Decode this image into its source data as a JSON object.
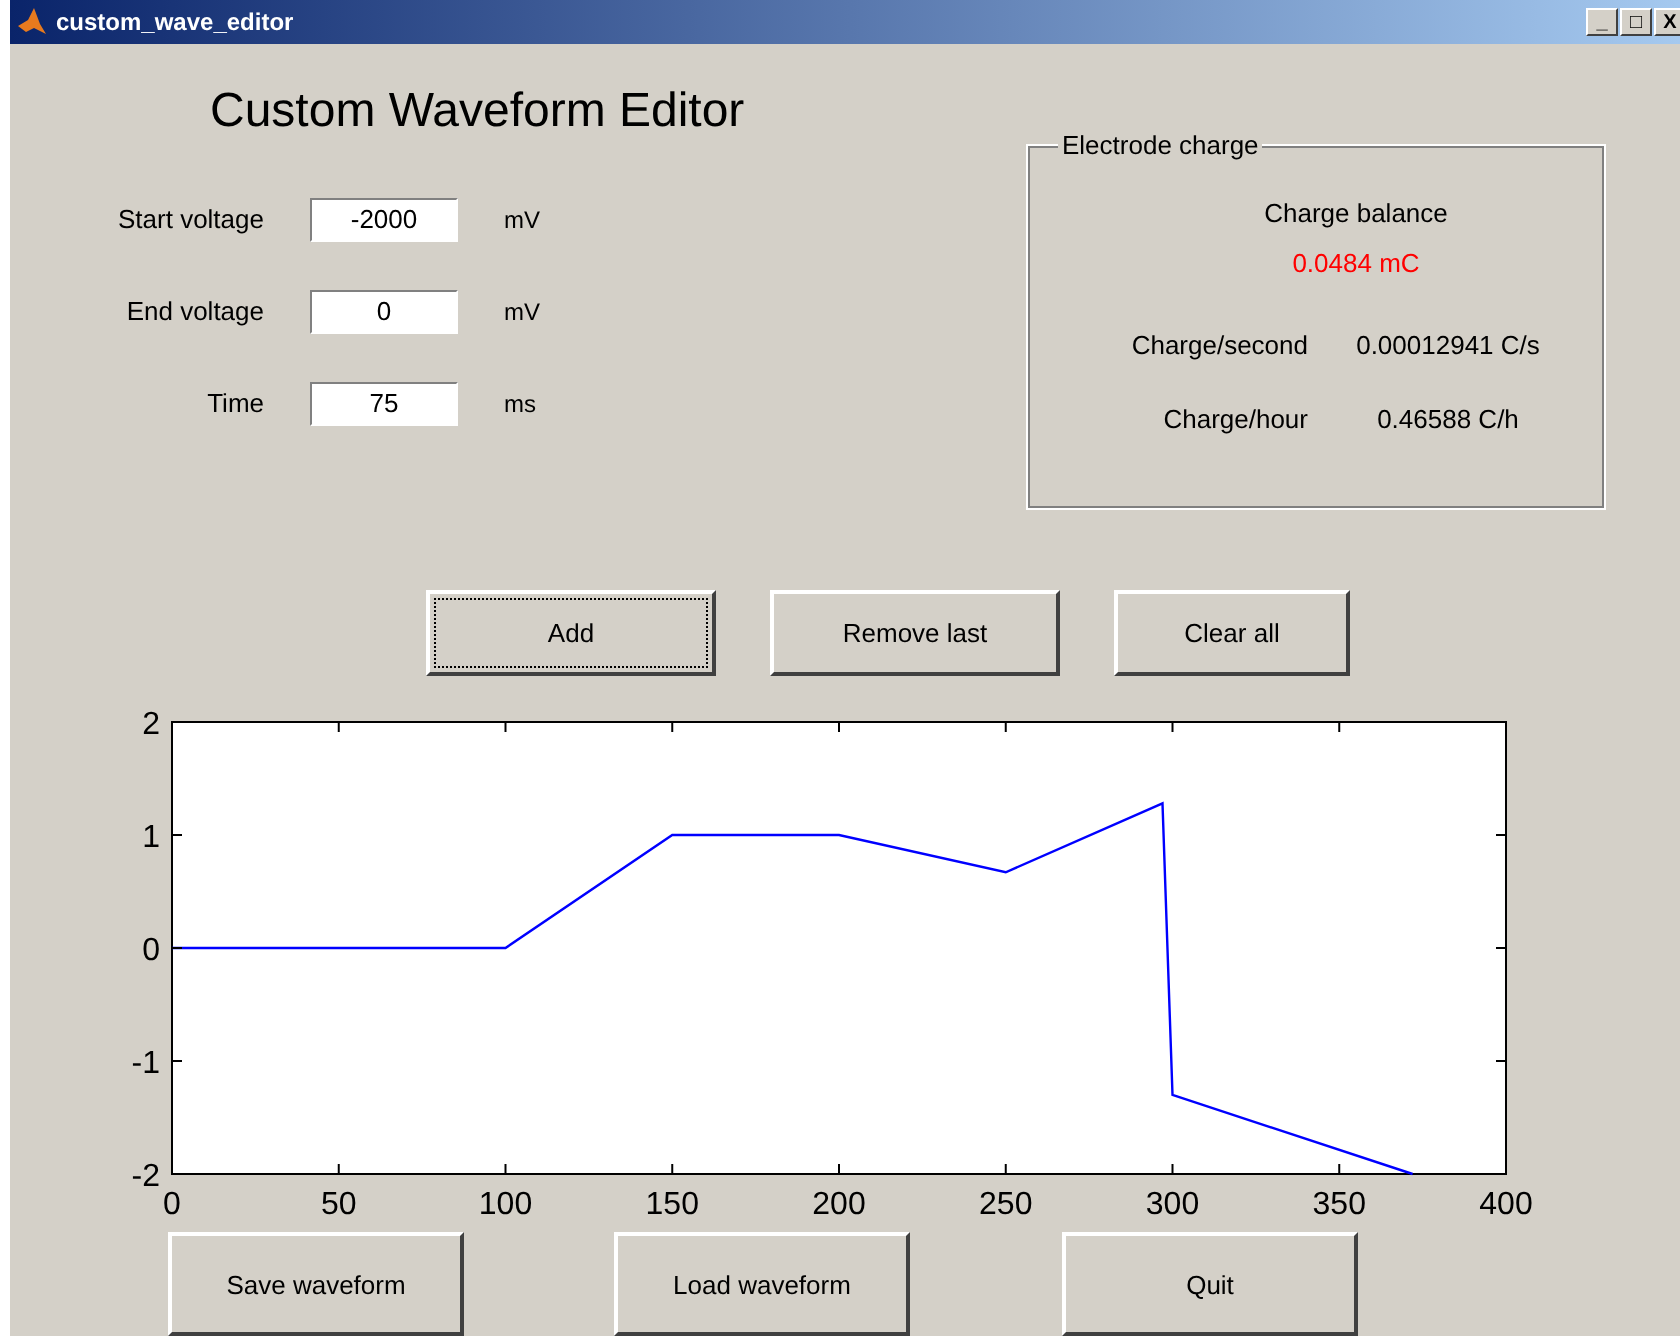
{
  "window": {
    "title": "custom_wave_editor",
    "controls": [
      "_",
      "□",
      "X"
    ]
  },
  "heading": "Custom Waveform Editor",
  "fields": [
    {
      "label": "Start voltage",
      "value": "-2000",
      "unit": "mV"
    },
    {
      "label": "End voltage",
      "value": "0",
      "unit": "mV"
    },
    {
      "label": "Time",
      "value": "75",
      "unit": "ms"
    }
  ],
  "electrode_charge": {
    "title": "Electrode charge",
    "balance_label": "Charge balance",
    "balance_value": "0.0484 mC",
    "rows": [
      {
        "label": "Charge/second",
        "value": "0.00012941 C/s"
      },
      {
        "label": "Charge/hour",
        "value": "0.46588 C/h"
      }
    ]
  },
  "edit_buttons": [
    {
      "label": "Add",
      "focused": true
    },
    {
      "label": "Remove last",
      "focused": false
    },
    {
      "label": "Clear all",
      "focused": false
    }
  ],
  "chart_data": {
    "type": "line",
    "x": [
      0,
      100,
      150,
      200,
      250,
      297,
      300,
      372
    ],
    "series": [
      {
        "color": "#0000ff",
        "values": [
          0,
          0,
          1,
          1,
          0.67,
          1.28,
          -1.3,
          -2
        ]
      }
    ],
    "xlim": [
      0,
      400
    ],
    "ylim": [
      -2,
      2
    ],
    "xticks": [
      0,
      50,
      100,
      150,
      200,
      250,
      300,
      350,
      400
    ],
    "yticks": [
      -2,
      -1,
      0,
      1,
      2
    ]
  },
  "file_buttons": [
    "Save waveform",
    "Load waveform",
    "Quit"
  ]
}
